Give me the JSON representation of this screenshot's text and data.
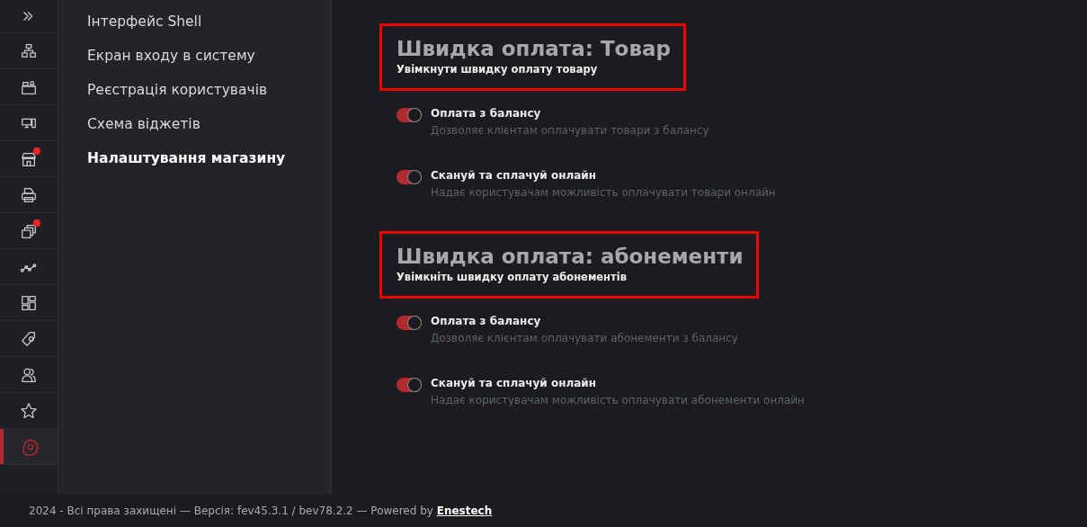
{
  "rail": {
    "items": [
      {
        "selected": false,
        "badge": false
      },
      {
        "selected": false,
        "badge": false
      },
      {
        "selected": false,
        "badge": false
      },
      {
        "selected": false,
        "badge": false
      },
      {
        "selected": false,
        "badge": true
      },
      {
        "selected": false,
        "badge": false
      },
      {
        "selected": false,
        "badge": true
      },
      {
        "selected": false,
        "badge": false
      },
      {
        "selected": false,
        "badge": false
      },
      {
        "selected": false,
        "badge": false
      },
      {
        "selected": false,
        "badge": false
      },
      {
        "selected": false,
        "badge": false
      },
      {
        "selected": true,
        "badge": false
      }
    ]
  },
  "nav": {
    "items": [
      {
        "label": "Інтерфейс Shell",
        "selected": false
      },
      {
        "label": "Екран входу в систему",
        "selected": false
      },
      {
        "label": "Реєстрація користувачів",
        "selected": false
      },
      {
        "label": "Схема віджетів",
        "selected": false
      },
      {
        "label": "Налаштування магазину",
        "selected": true
      }
    ]
  },
  "sections": [
    {
      "title": "Швидка оплата: Товар",
      "subtitle": "Увімкнути швидку оплату товару",
      "options": [
        {
          "label": "Оплата з балансу",
          "description": "Дозволяє клієнтам оплачувати товари з балансу",
          "checked": true
        },
        {
          "label": "Скануй та сплачуй онлайн",
          "description": "Надає користувачам можливість оплачувати товари онлайн",
          "checked": true
        }
      ]
    },
    {
      "title": "Швидка оплата: абонементи",
      "subtitle": "Увімкніть швидку оплату абонементів",
      "options": [
        {
          "label": "Оплата з балансу",
          "description": "Дозволяє клієнтам оплачувати абонементи з балансу",
          "checked": true
        },
        {
          "label": "Скануй та сплачуй онлайн",
          "description": "Надає користувачам можливість оплачувати абонементи онлайн",
          "checked": true
        }
      ]
    }
  ],
  "footer": {
    "text": "2024 - Всі права захищені — Версія: fev45.3.1 / bev78.2.2 — Powered by ",
    "link": "Enestech"
  }
}
